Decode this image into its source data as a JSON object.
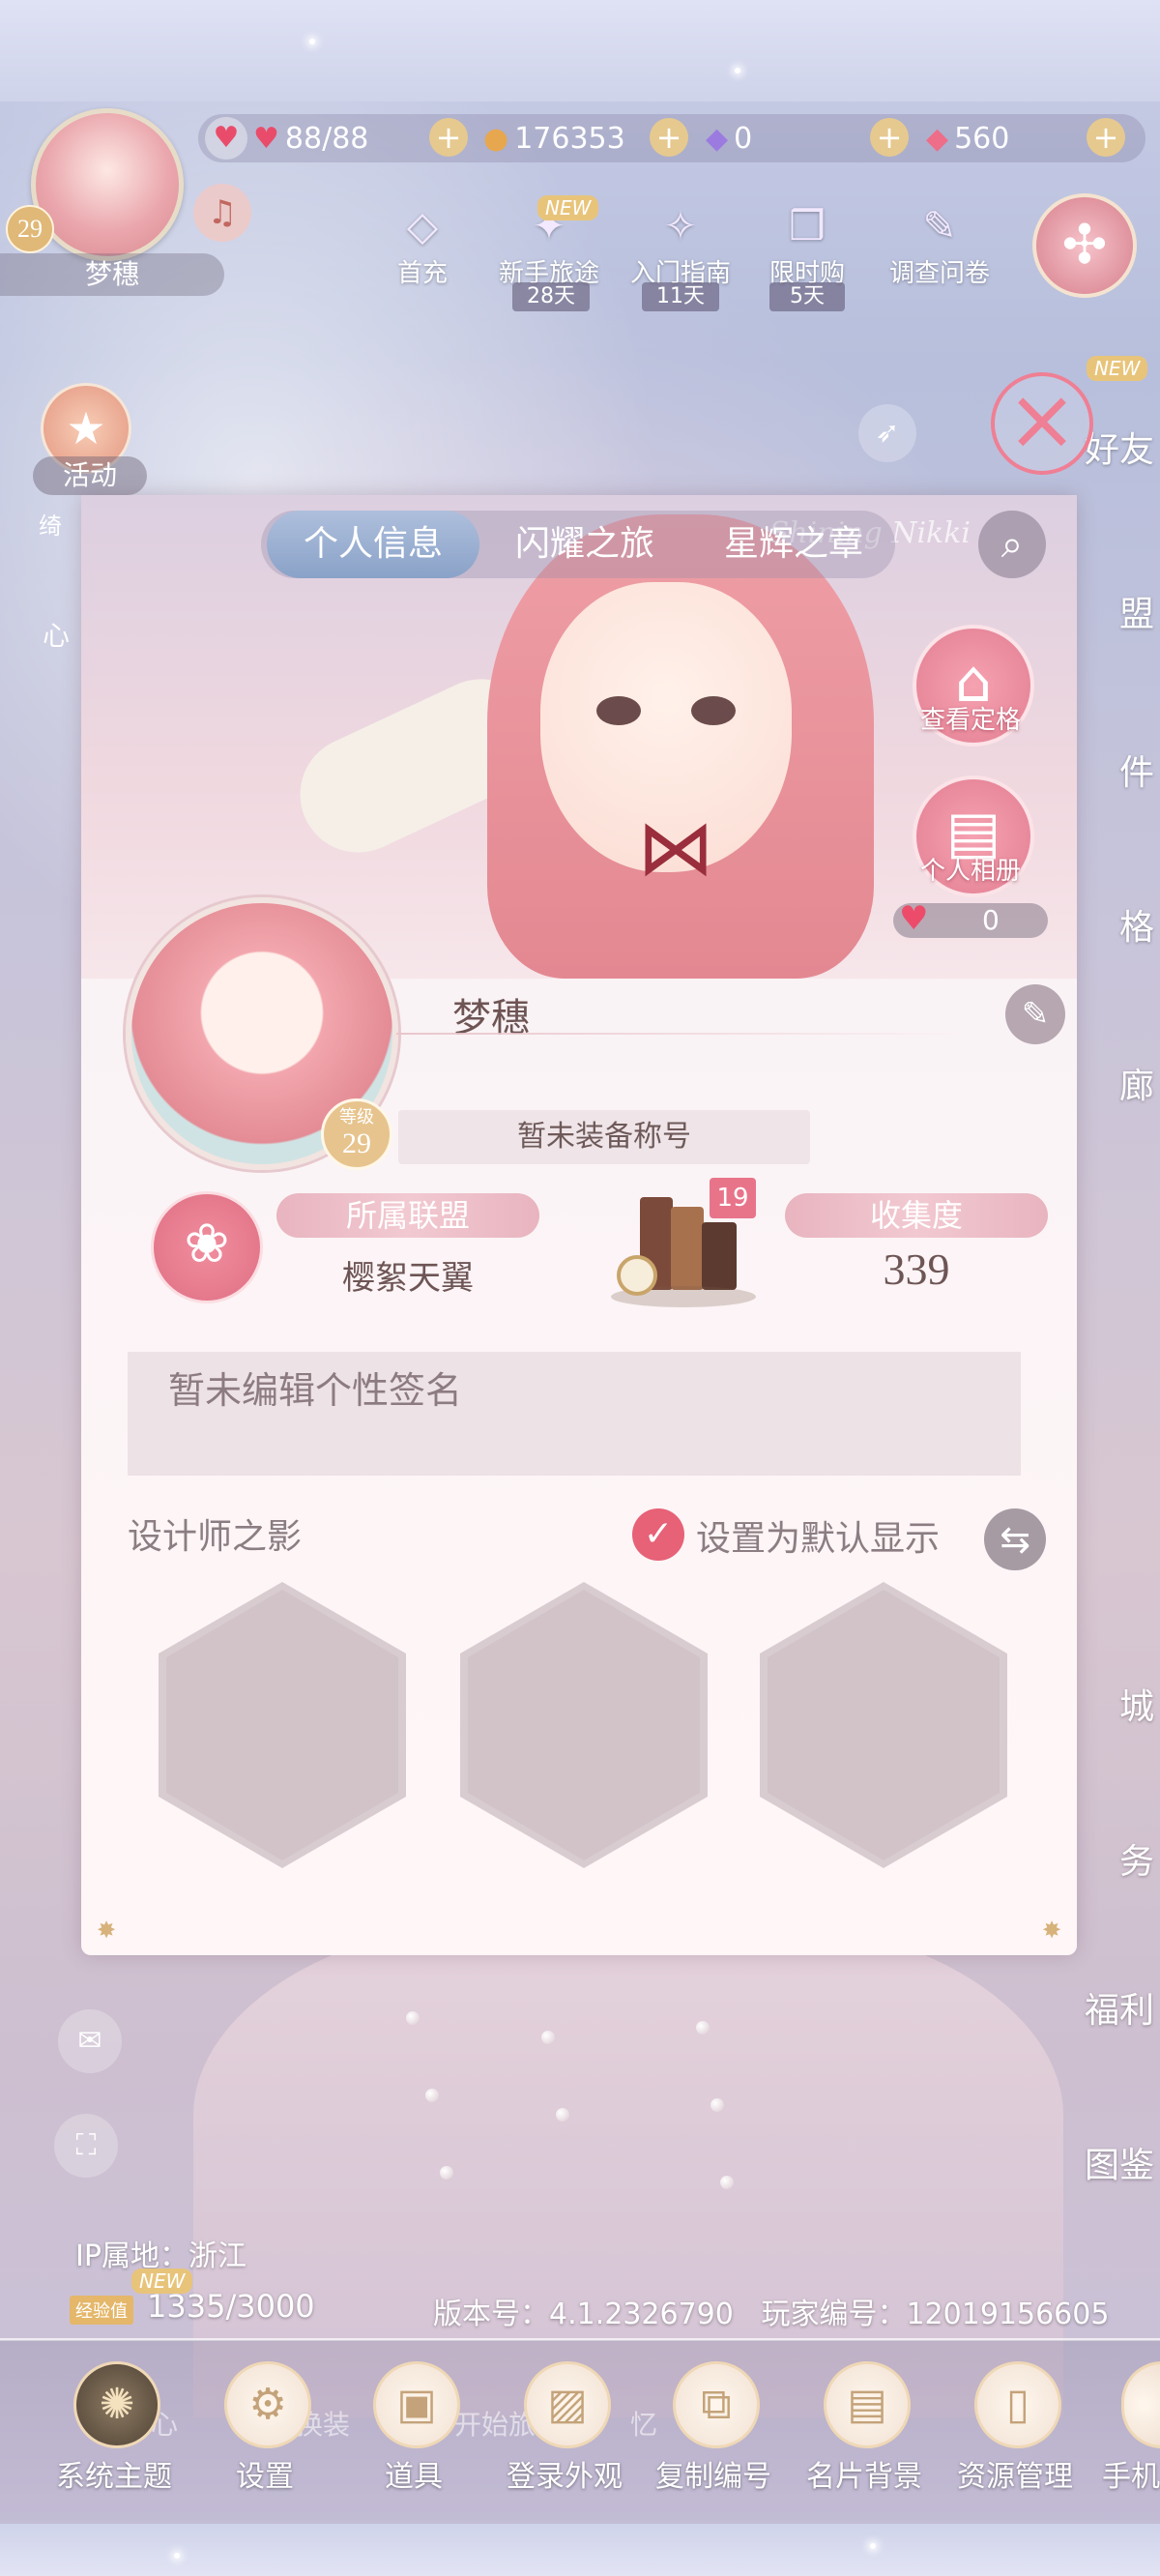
{
  "hud": {
    "player_level": "29",
    "player_name": "梦穗",
    "stamina": "88/88",
    "gold": "176353",
    "diamonds": "0",
    "crystals": "560",
    "top_buttons": [
      {
        "label": "首充",
        "icon": "diamond-gift-icon"
      },
      {
        "label": "新手旅途",
        "days": "28天",
        "new": "NEW",
        "icon": "suitcase-icon"
      },
      {
        "label": "入门指南",
        "days": "11天",
        "icon": "guide-icon"
      },
      {
        "label": "限时购",
        "days": "5天",
        "icon": "gift-box-icon"
      },
      {
        "label": "调查问卷",
        "icon": "feather-icon"
      }
    ],
    "left_side": [
      {
        "label": "活动"
      },
      {
        "label": "绮"
      },
      {
        "label": "心"
      }
    ],
    "right_side": [
      "好友",
      "盟",
      "件",
      "格",
      "廊",
      "城",
      "务",
      "福利",
      "图鉴"
    ],
    "new_tag": "NEW"
  },
  "panel": {
    "tabs": [
      "个人信息",
      "闪耀之旅",
      "星辉之章"
    ],
    "watermark": "Shining Nikki",
    "view_outfit": "查看定格",
    "album": "个人相册",
    "likes": "0",
    "level_label": "等级",
    "level": "29",
    "name": "梦穗",
    "title": "暂未装备称号",
    "alliance_label": "所属联盟",
    "alliance": "樱絮天翼",
    "book_badge": "19",
    "collection_label": "收集度",
    "collection": "339",
    "signature": "暂未编辑个性签名",
    "designer_label": "设计师之影",
    "default_label": "设置为默认显示"
  },
  "footer": {
    "ip": "IP属地：浙江",
    "exp_tag": "经验值",
    "exp": "1335/3000",
    "version": "版本号：4.1.2326790",
    "player_id": "玩家编号：12019156605",
    "new_tag": "NEW",
    "ghost_labels": [
      "心",
      "换装",
      "开始旅",
      "忆",
      "心"
    ]
  },
  "bottom_menu": [
    {
      "label": "系统主题",
      "icon": "theme-icon"
    },
    {
      "label": "设置",
      "icon": "gear-icon"
    },
    {
      "label": "道具",
      "icon": "bag-icon"
    },
    {
      "label": "登录外观",
      "icon": "image-icon"
    },
    {
      "label": "复制编号",
      "icon": "copy-icon"
    },
    {
      "label": "名片背景",
      "icon": "card-icon"
    },
    {
      "label": "资源管理",
      "icon": "storage-icon"
    },
    {
      "label": "手机",
      "icon": "phone-icon"
    }
  ],
  "colors": {
    "accent": "#e76177",
    "gold": "#e0b877",
    "tab_active": "#8aa2c8"
  }
}
